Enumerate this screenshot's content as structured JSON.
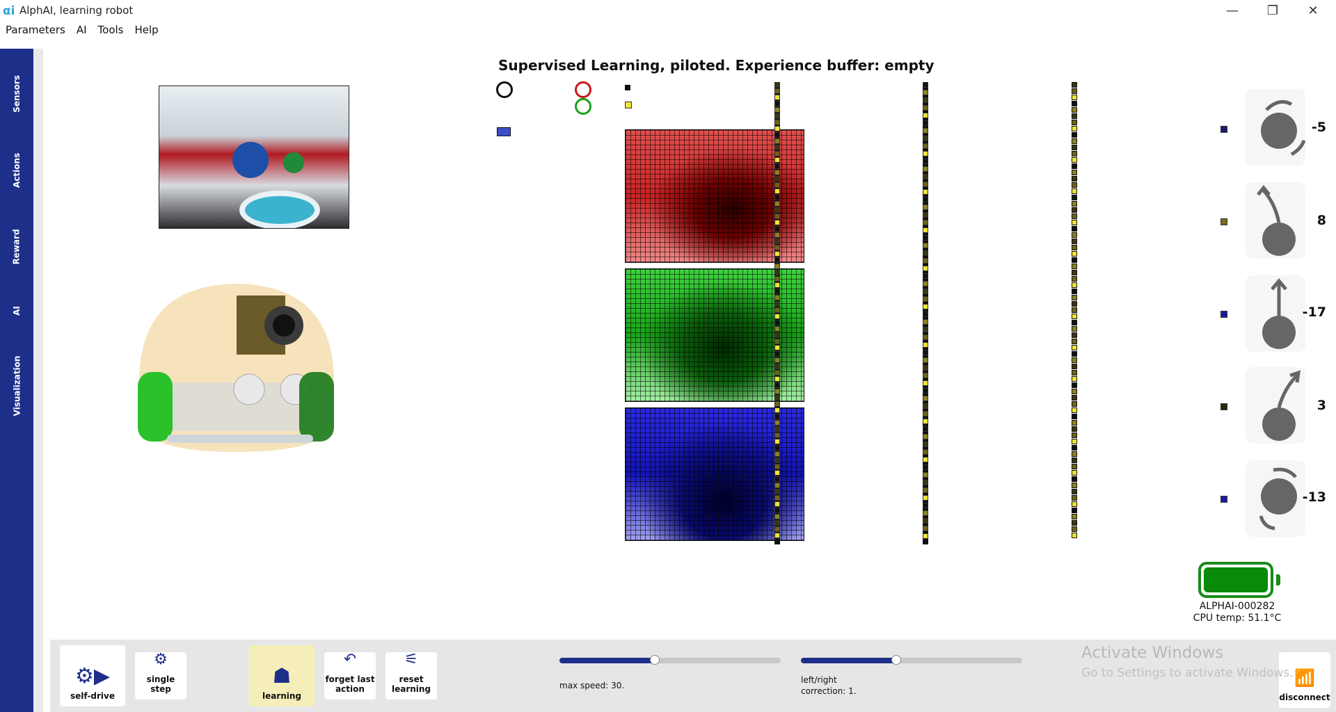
{
  "window": {
    "logo": "αi",
    "title": "AlphAI, learning robot",
    "minimize": "—",
    "restore": "❐",
    "close": "✕"
  },
  "menu": [
    "Parameters",
    "AI",
    "Tools",
    "Help"
  ],
  "sidebar": {
    "tabs": [
      "Sensors",
      "Actions",
      "Reward",
      "AI",
      "Visualization"
    ]
  },
  "main": {
    "title": "Supervised Learning, piloted. Experience buffer: empty"
  },
  "actions": [
    {
      "icon": "rotate-left-icon",
      "value": "-5"
    },
    {
      "icon": "turn-left-icon",
      "value": "8"
    },
    {
      "icon": "forward-icon",
      "value": "-17"
    },
    {
      "icon": "turn-right-icon",
      "value": "3"
    },
    {
      "icon": "rotate-right-icon",
      "value": "-13"
    }
  ],
  "status": {
    "device_id": "ALPHAI-000282",
    "cpu_temp": "CPU temp: 51.1°C",
    "battery_color": "#0a8a0a"
  },
  "toolbar": {
    "self_drive": "self-drive",
    "single_step": "single step",
    "learning": "learning",
    "forget_last_1": "forget last",
    "forget_last_2": "action",
    "reset_1": "reset",
    "reset_2": "learning",
    "disconnect": "disconnect",
    "max_speed_label": "max speed: 30.",
    "max_speed_fraction": 0.43,
    "lr_label_1": "left/right",
    "lr_label_2": "correction: 1.",
    "lr_fraction": 0.43
  },
  "watermark": {
    "line1": "Activate Windows",
    "line2": "Go to Settings to activate Windows."
  },
  "colors": {
    "sidebar": "#1e2f8a",
    "accent": "#1e2f8a",
    "learning_active": "#f6eeb8"
  }
}
